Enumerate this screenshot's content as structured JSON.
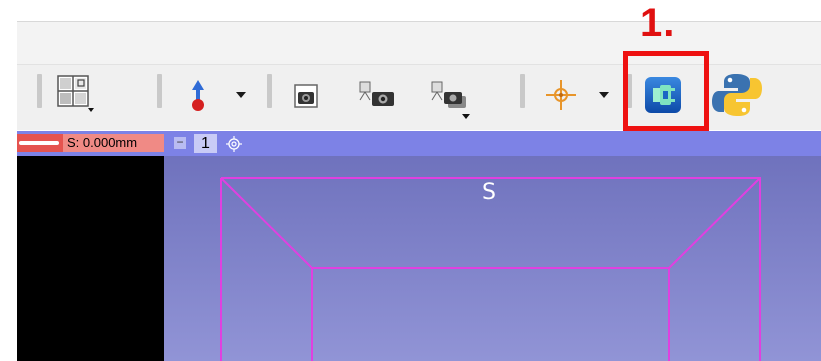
{
  "annotation": {
    "step_label": "1.",
    "highlight_color": "#ee1111"
  },
  "toolbar": {
    "items": [
      {
        "name": "layout-button",
        "icon": "layout-grid-icon",
        "has_dropdown": true
      },
      {
        "name": "mouse-mode-button",
        "icon": "fiducial-place-icon",
        "has_dropdown": true
      },
      {
        "name": "screenshot-button",
        "icon": "camera-icon",
        "has_dropdown": false
      },
      {
        "name": "scene-view-button",
        "icon": "scene-camera-icon",
        "has_dropdown": false
      },
      {
        "name": "scene-list-button",
        "icon": "scene-stack-icon",
        "has_dropdown": true
      },
      {
        "name": "crosshair-button",
        "icon": "crosshair-icon",
        "has_dropdown": true
      },
      {
        "name": "extension-manager-button",
        "icon": "extension-manager-icon",
        "has_dropdown": false
      },
      {
        "name": "python-console-button",
        "icon": "python-icon",
        "has_dropdown": false
      }
    ]
  },
  "slice_controls": {
    "offset_label": "S: 0.000mm",
    "collapse_glyph": "−",
    "layout_number": "1"
  },
  "view3d": {
    "orientation_label": "S"
  },
  "colors": {
    "viewbar": "#7d82e6",
    "slice_red": "#e5534f",
    "bounding_box": "#e040e0"
  }
}
